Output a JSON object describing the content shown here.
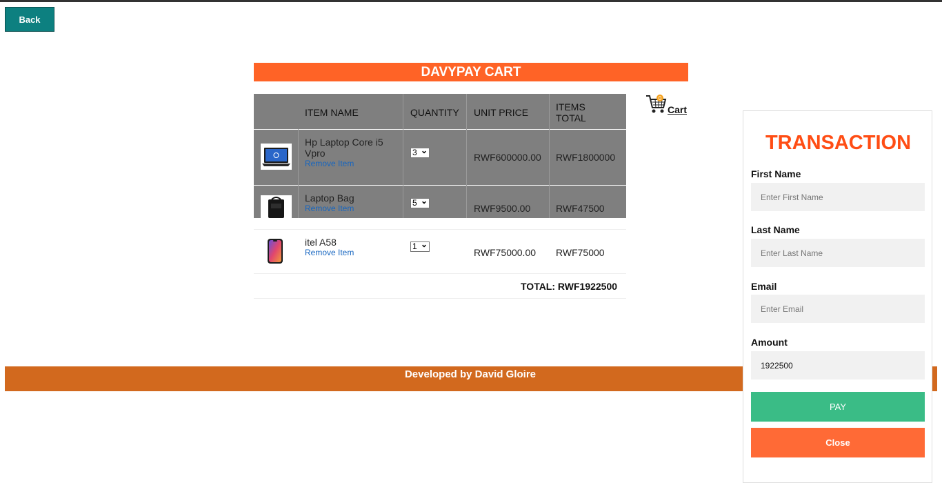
{
  "nav": {
    "back_label": "Back"
  },
  "cart": {
    "title": "DAVYPAY CART",
    "columns": [
      "ITEM NAME",
      "QUANTITY",
      "UNIT PRICE",
      "ITEMS TOTAL"
    ],
    "items": [
      {
        "name": "Hp Laptop Core i5 Vpro",
        "remove": "Remove Item",
        "qty": "3",
        "unit_price": "RWF600000.00",
        "total": "RWF1800000",
        "icon": "laptop-icon"
      },
      {
        "name": "Laptop Bag",
        "remove": "Remove Item",
        "qty": "5",
        "unit_price": "RWF9500.00",
        "total": "RWF47500",
        "icon": "laptop-bag-icon"
      },
      {
        "name": "itel A58",
        "remove": "Remove Item",
        "qty": "1",
        "unit_price": "RWF75000.00",
        "total": "RWF75000",
        "icon": "phone-icon"
      }
    ],
    "total_label": "TOTAL: RWF1922500",
    "cart_link": "Cart",
    "cart_badge": "0"
  },
  "transaction": {
    "title": "TRANSACTION",
    "first_name_label": "First Name",
    "first_name_placeholder": "Enter First Name",
    "last_name_label": "Last Name",
    "last_name_placeholder": "Enter Last Name",
    "email_label": "Email",
    "email_placeholder": "Enter Email",
    "amount_label": "Amount",
    "amount_value": "1922500",
    "pay_label": "PAY",
    "close_label": "Close"
  },
  "footer": {
    "text": "Developed by David Gloire"
  },
  "colors": {
    "accent": "#ff6326",
    "back": "#0d8080",
    "pay": "#3abc86",
    "footer": "#d2691e"
  }
}
